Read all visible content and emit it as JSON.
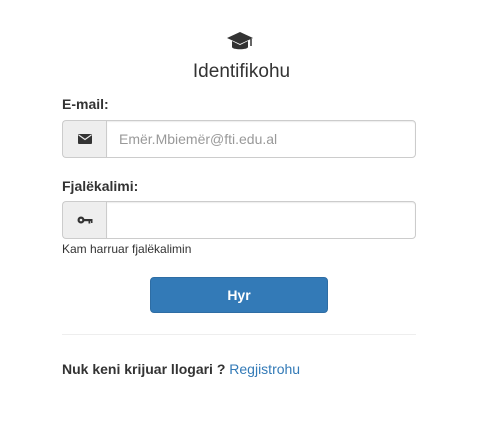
{
  "header": {
    "icon": "graduation-cap-icon",
    "title": "Identifikohu"
  },
  "form": {
    "email_label": "E-mail:",
    "email_icon": "envelope-icon",
    "email_placeholder": "Emër.Mbiemër@fti.edu.al",
    "email_value": "",
    "password_label": "Fjalëkalimi:",
    "password_icon": "key-icon",
    "password_placeholder": "",
    "password_value": "",
    "forgot_link": "Kam harruar fjalëkalimin",
    "submit_label": "Hyr"
  },
  "footer": {
    "question": "Nuk keni krijuar llogari ?",
    "register_link": "Regjistrohu"
  },
  "colors": {
    "primary": "#337ab7",
    "addon_bg": "#eeeeee",
    "border": "#cccccc"
  }
}
